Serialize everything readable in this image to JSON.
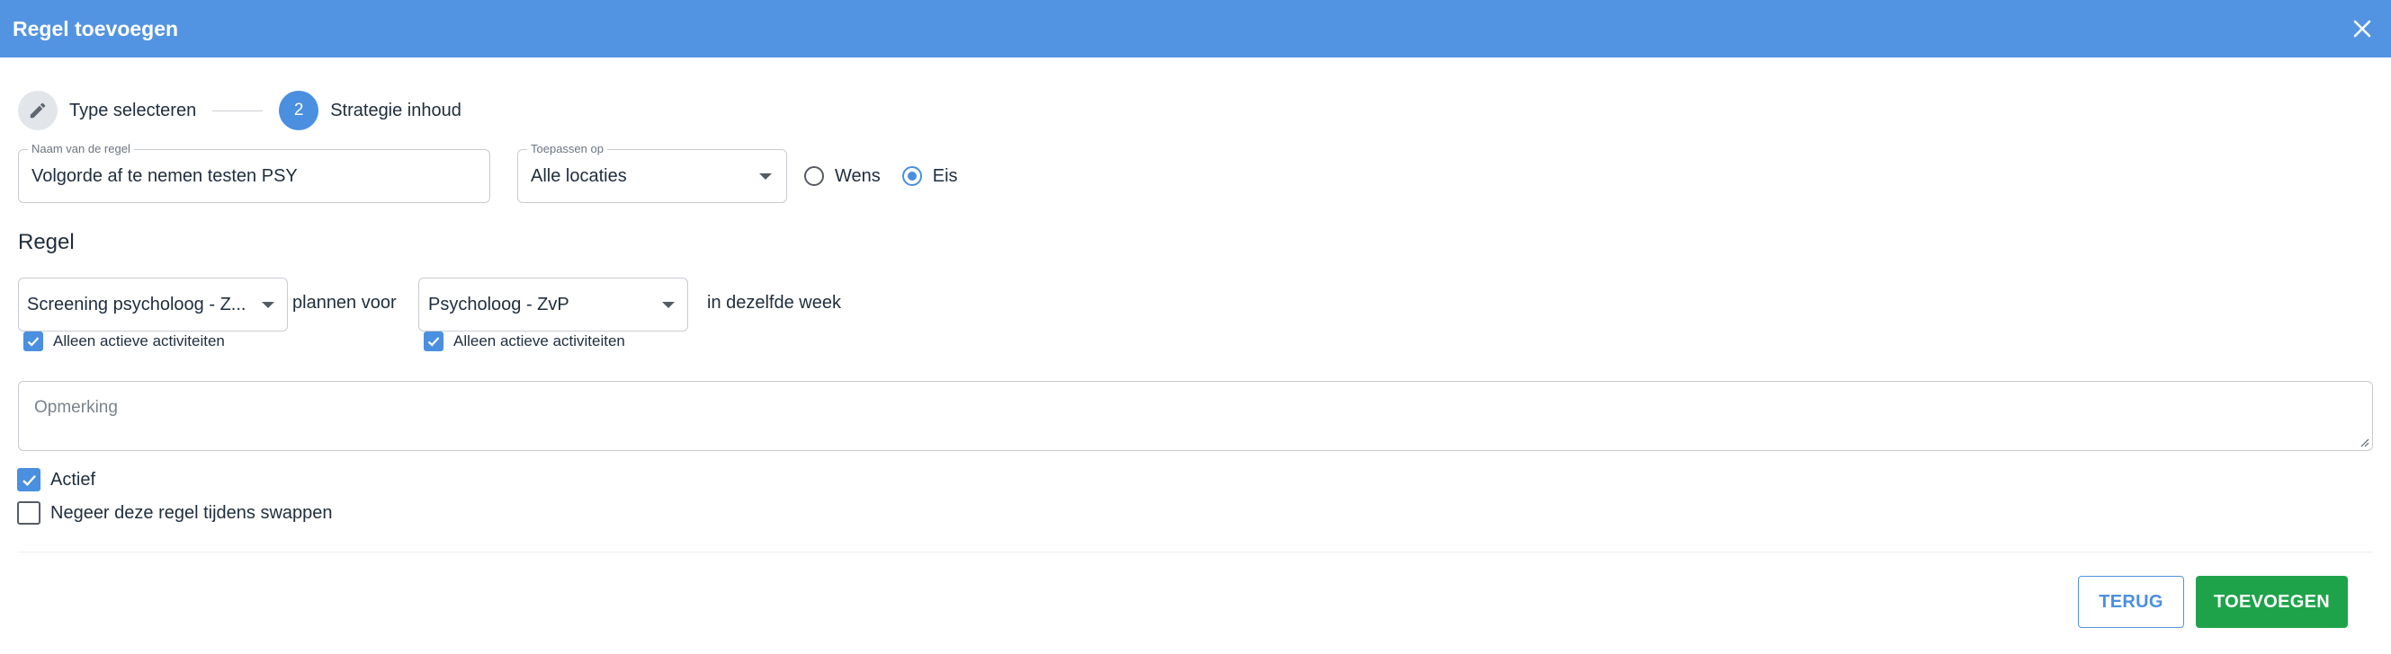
{
  "dialog": {
    "title": "Regel toevoegen",
    "close_icon": "close-icon"
  },
  "stepper": {
    "steps": [
      {
        "label": "Type selecteren",
        "icon": "pencil-icon",
        "state": "done"
      },
      {
        "number": "2",
        "label": "Strategie inhoud",
        "state": "active"
      }
    ]
  },
  "form": {
    "name": {
      "legend": "Naam van de regel",
      "value": "Volgorde af te nemen testen PSY"
    },
    "apply_to": {
      "legend": "Toepassen op",
      "value": "Alle locaties"
    },
    "type_options": [
      {
        "label": "Wens",
        "checked": false
      },
      {
        "label": "Eis",
        "checked": true
      }
    ]
  },
  "rule": {
    "title": "Regel",
    "activity_a": {
      "value": "Screening psycholoog - Z...",
      "only_active_label": "Alleen actieve activiteiten",
      "only_active_checked": true
    },
    "connector": "plannen voor",
    "activity_b": {
      "value": "Psycholoog - ZvP",
      "only_active_label": "Alleen actieve activiteiten",
      "only_active_checked": true
    },
    "suffix": "in dezelfde week"
  },
  "remark": {
    "placeholder": "Opmerking"
  },
  "options": {
    "active": {
      "label": "Actief",
      "checked": true
    },
    "ignore_swap": {
      "label": "Negeer deze regel tijdens swappen",
      "checked": false
    }
  },
  "buttons": {
    "back": "TERUG",
    "add": "TOEVOEGEN"
  },
  "colors": {
    "header": "#5294e2",
    "primary": "#4a8fe0",
    "success": "#1fa34a"
  }
}
